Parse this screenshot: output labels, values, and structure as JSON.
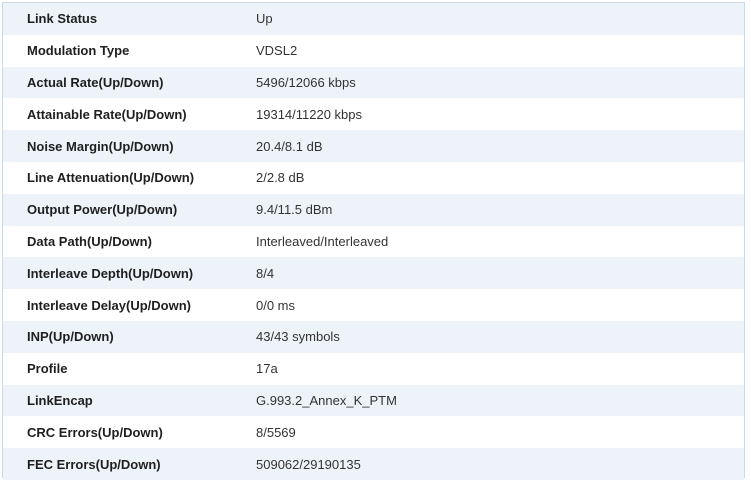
{
  "dsl_status": {
    "rows": [
      {
        "label": "Link Status",
        "value": "Up"
      },
      {
        "label": "Modulation Type",
        "value": "VDSL2"
      },
      {
        "label": "Actual Rate(Up/Down)",
        "value": "5496/12066 kbps"
      },
      {
        "label": "Attainable Rate(Up/Down)",
        "value": "19314/11220 kbps"
      },
      {
        "label": "Noise Margin(Up/Down)",
        "value": "20.4/8.1 dB"
      },
      {
        "label": "Line Attenuation(Up/Down)",
        "value": "2/2.8 dB"
      },
      {
        "label": "Output Power(Up/Down)",
        "value": "9.4/11.5 dBm"
      },
      {
        "label": "Data Path(Up/Down)",
        "value": "Interleaved/Interleaved"
      },
      {
        "label": "Interleave Depth(Up/Down)",
        "value": "8/4"
      },
      {
        "label": "Interleave Delay(Up/Down)",
        "value": "0/0 ms"
      },
      {
        "label": "INP(Up/Down)",
        "value": "43/43 symbols"
      },
      {
        "label": "Profile",
        "value": "17a"
      },
      {
        "label": "LinkEncap",
        "value": "G.993.2_Annex_K_PTM"
      },
      {
        "label": "CRC Errors(Up/Down)",
        "value": "8/5569"
      },
      {
        "label": "FEC Errors(Up/Down)",
        "value": "509062/29190135"
      }
    ]
  }
}
